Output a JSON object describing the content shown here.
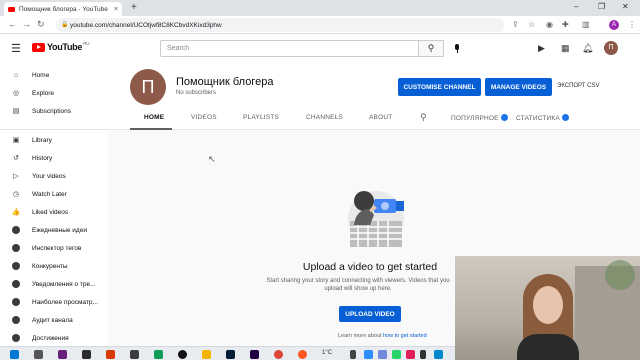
{
  "browser": {
    "tab_title": "Помощник блогера - YouTube",
    "tab_close": "×",
    "new_tab": "+",
    "url": "youtube.com/channel/UCOtjwf8C8KCbvdXKixd3phw",
    "profile_letter": "A",
    "win_min": "–",
    "win_max": "❐",
    "win_close": "✕",
    "back": "←",
    "forward": "→",
    "reload": "↻",
    "menu": "⋮"
  },
  "header": {
    "logo_text": "YouTube",
    "logo_region": "RU",
    "search_placeholder": "Search",
    "avatar_letter": "П"
  },
  "sidebar": {
    "items": [
      {
        "label": "Home",
        "icon": "home-icon",
        "glyph": "⌂"
      },
      {
        "label": "Explore",
        "icon": "compass-icon",
        "glyph": "◎"
      },
      {
        "label": "Subscriptions",
        "icon": "subscriptions-icon",
        "glyph": "▤"
      },
      {
        "label": "Library",
        "icon": "library-icon",
        "glyph": "▣"
      },
      {
        "label": "History",
        "icon": "history-icon",
        "glyph": "↺"
      },
      {
        "label": "Your videos",
        "icon": "your-videos-icon",
        "glyph": "▷"
      },
      {
        "label": "Watch Later",
        "icon": "clock-icon",
        "glyph": "◷"
      },
      {
        "label": "Liked videos",
        "icon": "thumb-up-icon",
        "glyph": "👍"
      },
      {
        "label": "Ежедневные идеи",
        "icon": "playlist-icon",
        "glyph": ""
      },
      {
        "label": "Инспектор тегов",
        "icon": "playlist-icon",
        "glyph": ""
      },
      {
        "label": "Конкуренты",
        "icon": "playlist-icon",
        "glyph": ""
      },
      {
        "label": "Уведомления о тре...",
        "icon": "playlist-icon",
        "glyph": ""
      },
      {
        "label": "Наиболее просматр...",
        "icon": "playlist-icon",
        "glyph": ""
      },
      {
        "label": "Аудит канала",
        "icon": "playlist-icon",
        "glyph": ""
      },
      {
        "label": "Достижения",
        "icon": "playlist-icon",
        "glyph": ""
      }
    ]
  },
  "channel": {
    "avatar_letter": "П",
    "name": "Помощник блогера",
    "subscribers": "No subscribers",
    "customise_button": "CUSTOMISE CHANNEL",
    "manage_button": "MANAGE VIDEOS",
    "export_label": "ЭКСПОРТ CSV",
    "tabs": {
      "home": "HOME",
      "videos": "VIDEOS",
      "playlists": "PLAYLISTS",
      "channels": "CHANNELS",
      "about": "ABOUT",
      "popular": "ПОПУЛЯРНОЕ",
      "stats": "СТАТИСТИКА"
    }
  },
  "main": {
    "title": "Upload a video to get started",
    "subtitle": "Start sharing your story and connecting with viewers. Videos that you upload will show up here.",
    "upload_button": "UPLOAD VIDEO",
    "learn_more": "Learn more about",
    "learn_link": "how to get started"
  },
  "taskbar": {
    "weather": "1°C"
  },
  "colors": {
    "accent_blue": "#065fd4",
    "youtube_red": "#ff0000"
  }
}
